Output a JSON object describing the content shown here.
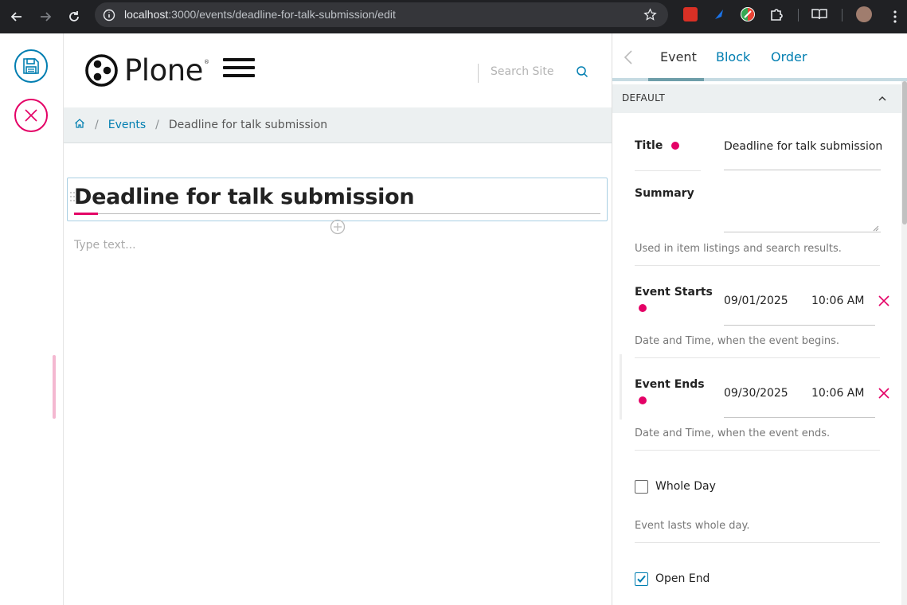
{
  "browser": {
    "url_host": "localhost",
    "url_rest": ":3000/events/deadline-for-talk-submission/edit"
  },
  "header": {
    "logo_text": "Plone",
    "logo_mark": "®",
    "search_placeholder": "Search Site"
  },
  "breadcrumbs": {
    "items": [
      "Events",
      "Deadline for talk submission"
    ]
  },
  "editor": {
    "title": "Deadline for talk submission",
    "text_placeholder": "Type text..."
  },
  "sidebar": {
    "tabs": [
      "Event",
      "Block",
      "Order"
    ],
    "section": "DEFAULT",
    "fields": {
      "title_label": "Title",
      "title_value": "Deadline for talk submission",
      "summary_label": "Summary",
      "summary_help": "Used in item listings and search results.",
      "start_label": "Event Starts",
      "start_date": "09/01/2025",
      "start_time": "10:06 AM",
      "start_help": "Date and Time, when the event begins.",
      "end_label": "Event Ends",
      "end_date": "09/30/2025",
      "end_time": "10:06 AM",
      "end_help": "Date and Time, when the event ends.",
      "whole_day_label": "Whole Day",
      "whole_day_checked": false,
      "whole_day_help": "Event lasts whole day.",
      "open_end_label": "Open End",
      "open_end_checked": true
    }
  },
  "colors": {
    "accent_blue": "#007eb1",
    "accent_pink": "#e40166"
  }
}
